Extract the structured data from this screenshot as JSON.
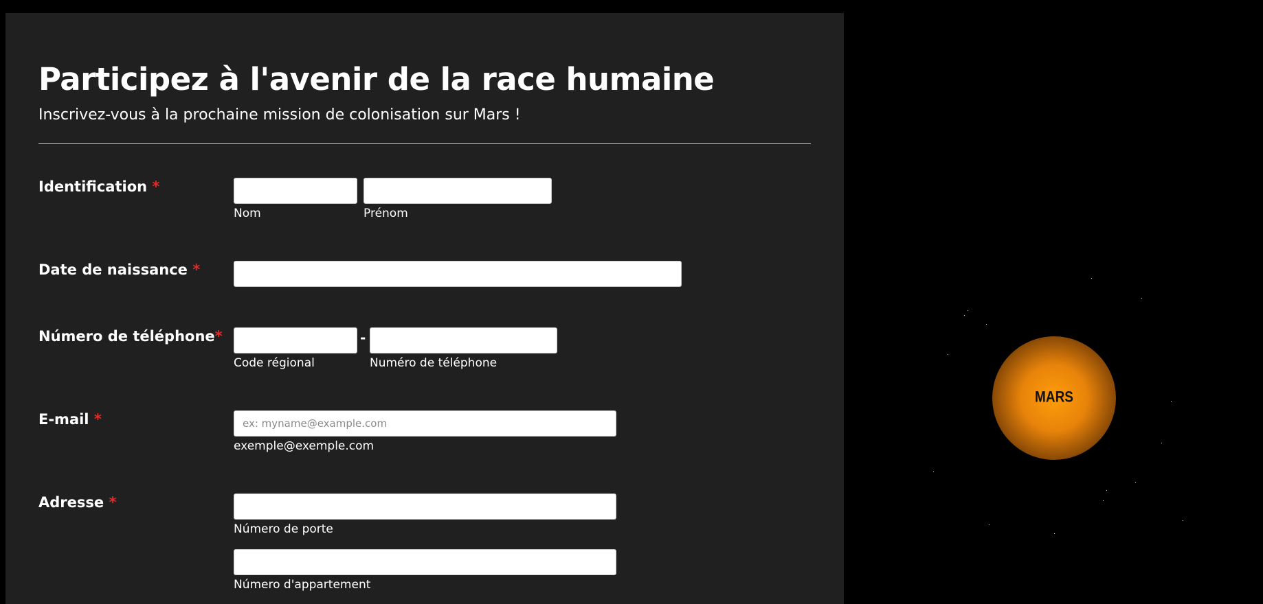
{
  "header": {
    "title": "Participez à l'avenir de la race humaine",
    "subtitle": "Inscrivez-vous à la prochaine mission de colonisation sur Mars !"
  },
  "form": {
    "required_mark": "*",
    "identification": {
      "label": "Identification",
      "first_sublabel": "Nom",
      "second_sublabel": "Prénom"
    },
    "birthdate": {
      "label": "Date de naissance"
    },
    "phone": {
      "label": "Número de téléphone",
      "separator": "-",
      "area_sublabel": "Code régional",
      "number_sublabel": "Numéro de téléphone"
    },
    "email": {
      "label": "E-mail",
      "placeholder": "ex: myname@example.com",
      "sublabel": "exemple@exemple.com"
    },
    "address": {
      "label": "Adresse",
      "door_sublabel": "Número de porte",
      "apartment_sublabel": "Número d'appartement"
    }
  },
  "illustration": {
    "planet_label": "MARS",
    "planet_color": "#f28c0f",
    "background_color": "#000000"
  },
  "colors": {
    "panel": "#202020",
    "required": "#e02b2b",
    "text": "#ffffff"
  }
}
